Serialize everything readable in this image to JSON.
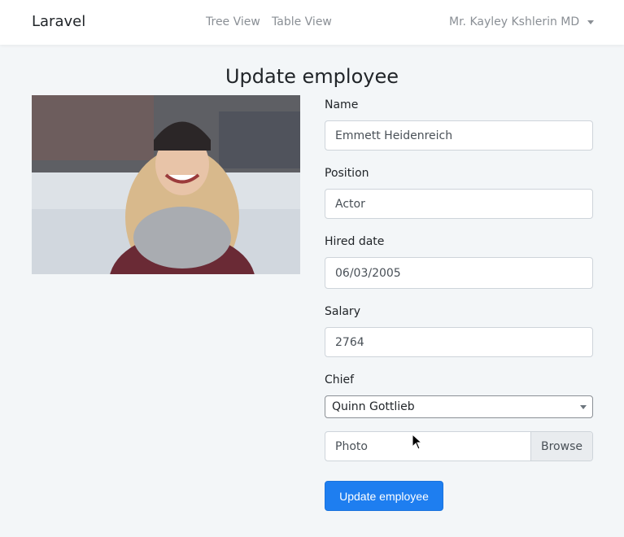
{
  "navbar": {
    "brand": "Laravel",
    "links": [
      "Tree View",
      "Table View"
    ],
    "user": "Mr. Kayley Kshlerin MD"
  },
  "page": {
    "title": "Update employee"
  },
  "form": {
    "name": {
      "label": "Name",
      "value": "Emmett Heidenreich"
    },
    "position": {
      "label": "Position",
      "value": "Actor"
    },
    "hired_date": {
      "label": "Hired date",
      "value": "06/03/2005"
    },
    "salary": {
      "label": "Salary",
      "value": "2764"
    },
    "chief": {
      "label": "Chief",
      "value": "Quinn Gottlieb"
    },
    "photo": {
      "placeholder": "Photo",
      "browse": "Browse"
    },
    "submit": "Update employee"
  },
  "colors": {
    "primary": "#1e7ef0",
    "background": "#f3f6f8",
    "nav_link": "#8a8f95"
  },
  "icons": [
    "caret-down-icon",
    "mouse-pointer-icon"
  ]
}
